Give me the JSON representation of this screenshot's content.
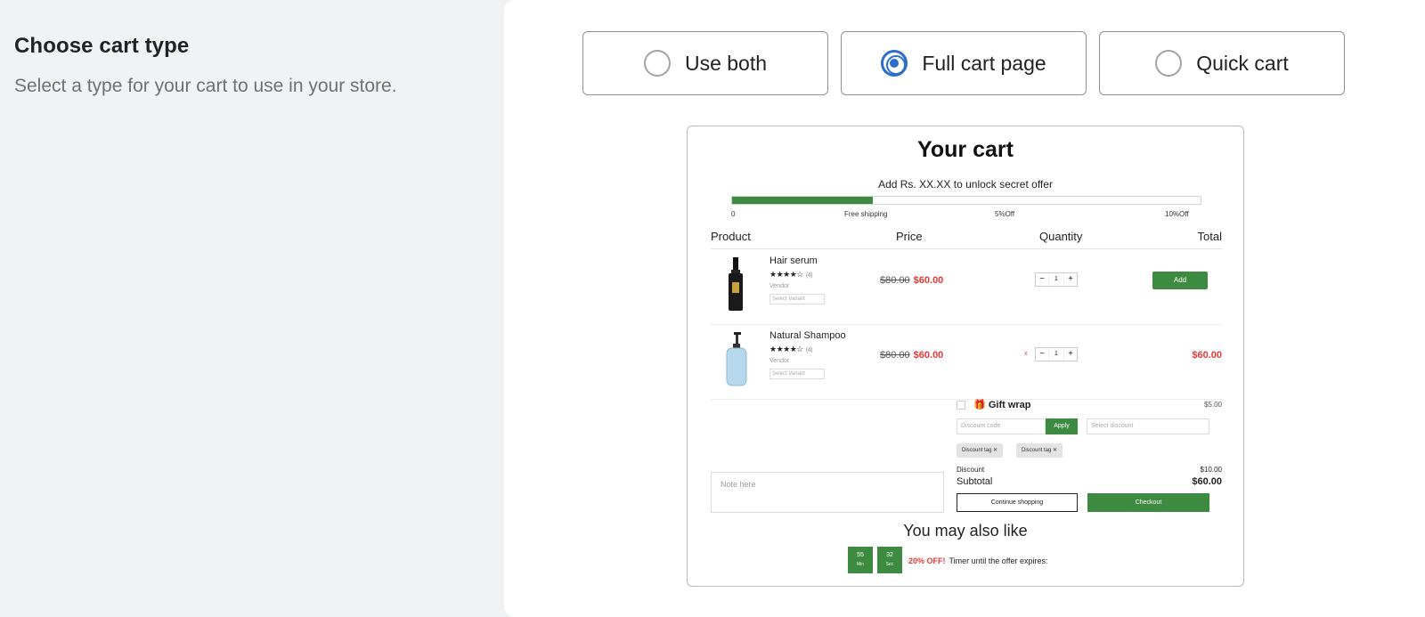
{
  "section": {
    "title": "Choose cart type",
    "description": "Select a type for your cart to use in your store."
  },
  "options": [
    {
      "label": "Use both",
      "selected": false
    },
    {
      "label": "Full cart page",
      "selected": true
    },
    {
      "label": "Quick cart",
      "selected": false
    }
  ],
  "preview": {
    "title": "Your cart",
    "offer_text": "Add Rs. XX.XX to unlock secret offer",
    "progress_fraction": 0.3,
    "milestones": [
      "0",
      "Free shipping",
      "5%Off",
      "10%Off"
    ],
    "columns": {
      "product": "Product",
      "price": "Price",
      "quantity": "Quantity",
      "total": "Total"
    },
    "items": [
      {
        "name": "Hair serum",
        "stars": "★★★★☆",
        "reviews": "(4)",
        "vendor": "Vendor",
        "variant": "Select Variant",
        "old_price": "$80.00",
        "price": "$60.00",
        "qty": "1",
        "action": "Add"
      },
      {
        "name": "Natural Shampoo",
        "stars": "★★★★☆",
        "reviews": "(4)",
        "vendor": "Vendor",
        "variant": "Select Variant",
        "old_price": "$80.00",
        "price": "$60.00",
        "qty": "1",
        "remove": "x",
        "total": "$60.00"
      }
    ],
    "gift_wrap": {
      "label": "Gift wrap",
      "price": "$5.00"
    },
    "discount": {
      "placeholder": "Discount code",
      "apply": "Apply",
      "select": "Select discount",
      "tags": [
        "Discount tag",
        "Discount tag"
      ]
    },
    "summary": {
      "discount_label": "Discount",
      "discount_value": "$10.00",
      "subtotal_label": "Subtotal",
      "subtotal_value": "$60.00"
    },
    "note_placeholder": "Note here",
    "continue_label": "Continue shopping",
    "checkout_label": "Checkout",
    "also_like": "You may also like",
    "timer": {
      "min": "55",
      "min_label": "Min",
      "sec": "32",
      "sec_label": "Sec",
      "off": "20% OFF!",
      "text": "Timer until the offer expires:"
    }
  },
  "colors": {
    "accent": "#2c6ecb",
    "green": "#3d8b40",
    "sale": "#e53935"
  }
}
